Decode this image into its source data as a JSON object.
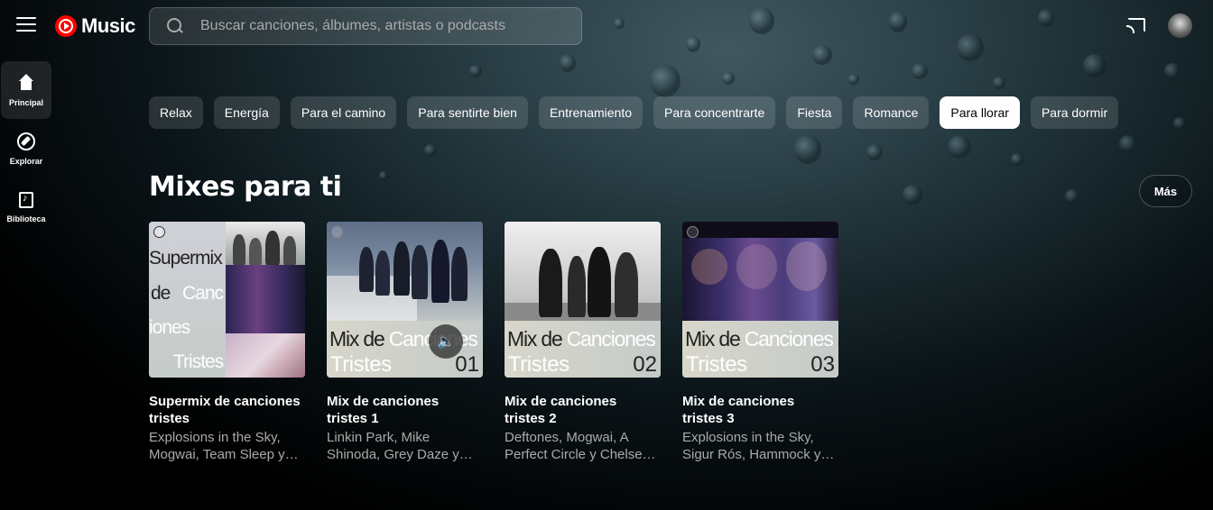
{
  "app": {
    "logo_text": "Music",
    "brand_color": "#ff0000"
  },
  "header": {
    "search_placeholder": "Buscar canciones, álbumes, artistas o podcasts",
    "menu_icon": "hamburger-menu-icon",
    "cast_icon": "cast-icon",
    "avatar_icon": "user-avatar"
  },
  "sidebar": {
    "items": [
      {
        "label": "Principal",
        "icon": "home-icon",
        "active": true
      },
      {
        "label": "Explorar",
        "icon": "compass-icon",
        "active": false
      },
      {
        "label": "Biblioteca",
        "icon": "library-icon",
        "active": false
      }
    ]
  },
  "chips": [
    {
      "label": "Relax"
    },
    {
      "label": "Energía"
    },
    {
      "label": "Para el camino"
    },
    {
      "label": "Para sentirte bien"
    },
    {
      "label": "Entrenamiento"
    },
    {
      "label": "Para concentrarte"
    },
    {
      "label": "Fiesta"
    },
    {
      "label": "Romance"
    },
    {
      "label": "Para llorar",
      "selected": true
    },
    {
      "label": "Para dormir"
    }
  ],
  "section": {
    "title": "Mixes para ti",
    "more_label": "Más"
  },
  "cards": [
    {
      "title": "Supermix de canciones tristes",
      "subtitle": "Explosions in the Sky, Mogwai, Team Sleep y…",
      "thumb_words": [
        "Supermix",
        "de",
        "Canc",
        "iones",
        "Tristes"
      ]
    },
    {
      "title": "Mix de canciones tristes 1",
      "subtitle": "Linkin Park, Mike Shinoda, Grey Daze y…",
      "thumb_line1_dark": "Mix de",
      "thumb_line1_light": "Canciones",
      "thumb_line2": "Tristes",
      "thumb_number": "01"
    },
    {
      "title": "Mix de canciones tristes 2",
      "subtitle": "Deftones, Mogwai, A Perfect Circle y Chelse…",
      "thumb_line1_dark": "Mix de",
      "thumb_line1_light": "Canciones",
      "thumb_line2": "Tristes",
      "thumb_number": "02"
    },
    {
      "title": "Mix de canciones tristes 3",
      "subtitle": "Explosions in the Sky, Sigur Rós, Hammock y…",
      "thumb_line1_dark": "Mix de",
      "thumb_line1_light": "Canciones",
      "thumb_line2": "Tristes",
      "thumb_number": "03"
    }
  ]
}
